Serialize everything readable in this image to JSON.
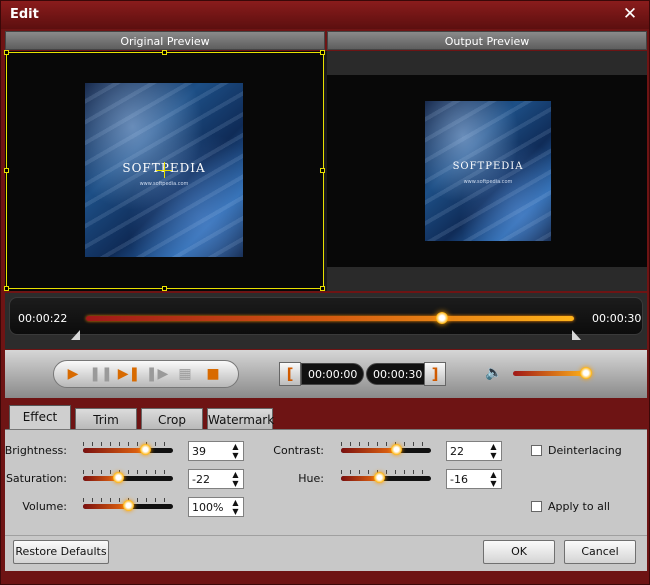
{
  "window": {
    "title": "Edit"
  },
  "preview": {
    "original_header": "Original Preview",
    "output_header": "Output Preview"
  },
  "video": {
    "brand": "SOFTPEDIA",
    "url": "www.softpedia.com"
  },
  "timeline": {
    "current_time": "00:00:22",
    "end_time": "00:00:30",
    "playhead_fraction": 0.73
  },
  "controls": {
    "play_icon": "play-icon",
    "trim_start": "00:00:00",
    "trim_end": "00:00:30",
    "start_bracket": "[",
    "end_bracket": "]",
    "volume_fraction": 1.0
  },
  "tabs": [
    {
      "label": "Effect",
      "active": true
    },
    {
      "label": "Trim",
      "active": false
    },
    {
      "label": "Crop",
      "active": false
    },
    {
      "label": "Watermark",
      "active": false
    }
  ],
  "effect": {
    "brightness": {
      "label": "Brightness:",
      "value": "39",
      "fraction": 0.69
    },
    "saturation": {
      "label": "Saturation:",
      "value": "-22",
      "fraction": 0.39
    },
    "volume": {
      "label": "Volume:",
      "value": "100%",
      "fraction": 0.5
    },
    "contrast": {
      "label": "Contrast:",
      "value": "22",
      "fraction": 0.61
    },
    "hue": {
      "label": "Hue:",
      "value": "-16",
      "fraction": 0.42
    },
    "deinterlacing": {
      "label": "Deinterlacing",
      "checked": false
    },
    "apply_to_all": {
      "label": "Apply to all",
      "checked": false
    }
  },
  "footer": {
    "restore": "Restore Defaults",
    "ok": "OK",
    "cancel": "Cancel"
  }
}
